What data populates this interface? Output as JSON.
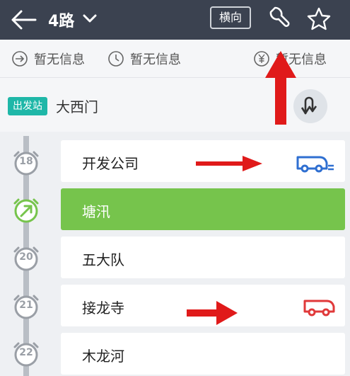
{
  "header": {
    "route": "4路",
    "orientation_button": "横向"
  },
  "info": [
    {
      "icon": "direction-icon",
      "label": "暂无信息"
    },
    {
      "icon": "clock-icon",
      "label": "暂无信息"
    },
    {
      "icon": "yuan-icon",
      "label": "暂无信息"
    }
  ],
  "departure": {
    "badge": "出发站",
    "station": "大西门"
  },
  "stations": [
    {
      "seq": "18",
      "name": "开发公司",
      "state": "bus-arrived"
    },
    {
      "seq": "",
      "name": "塘汛",
      "state": "current"
    },
    {
      "seq": "20",
      "name": "五大队",
      "state": "normal"
    },
    {
      "seq": "21",
      "name": "接龙寺",
      "state": "bus-approaching"
    },
    {
      "seq": "22",
      "name": "木龙河",
      "state": "normal"
    }
  ],
  "colors": {
    "topbar": "#3b4250",
    "active": "#76c44c",
    "badge": "#1fb7a8",
    "bus_blue": "#2f6fd1",
    "bus_red": "#e0393a",
    "annotation_red": "#e01a1a"
  }
}
